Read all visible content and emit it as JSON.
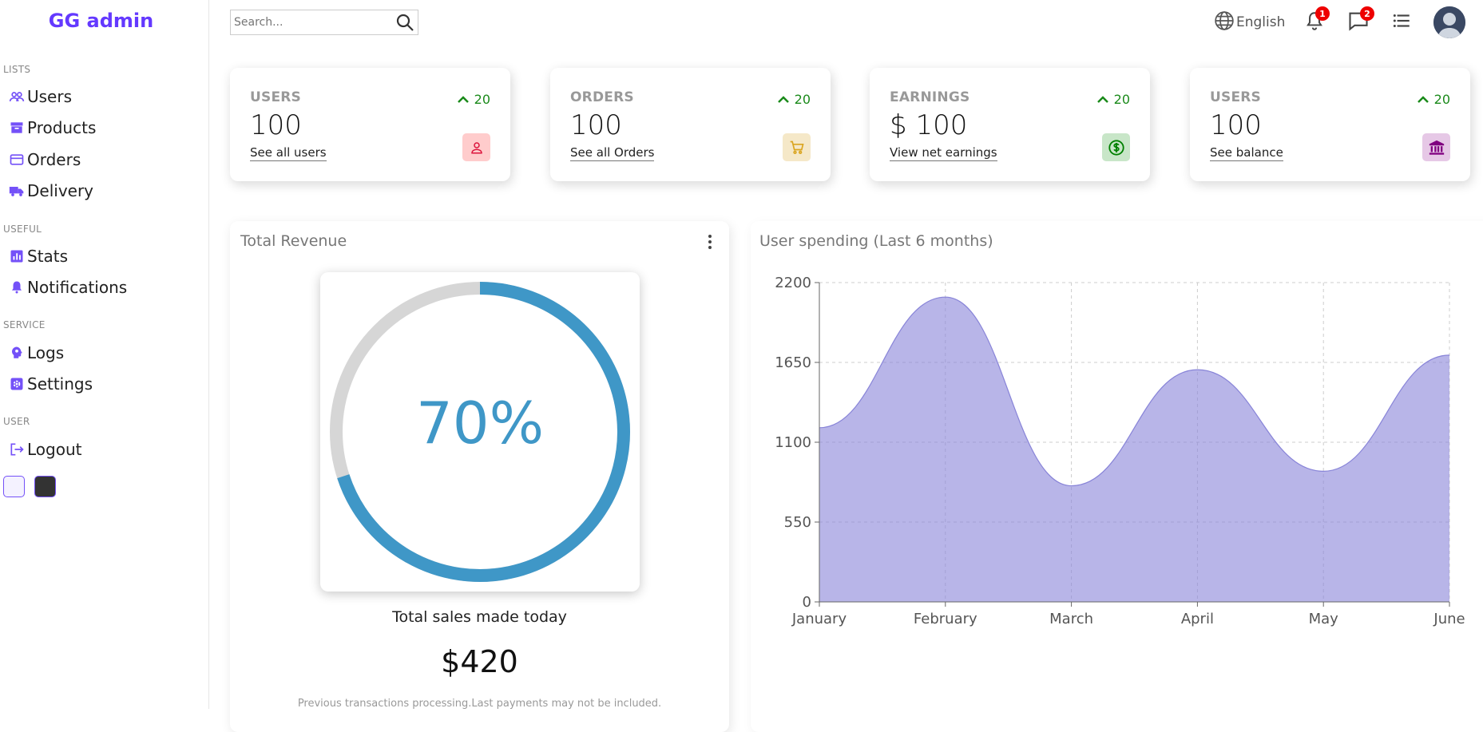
{
  "sidebar": {
    "logo": "GG admin",
    "sections": [
      {
        "title": "LISTS",
        "items": [
          {
            "label": "Users",
            "icon": "people-icon"
          },
          {
            "label": "Products",
            "icon": "archive-icon"
          },
          {
            "label": "Orders",
            "icon": "credit-card-icon"
          },
          {
            "label": "Delivery",
            "icon": "truck-icon"
          }
        ]
      },
      {
        "title": "USEFUL",
        "items": [
          {
            "label": "Stats",
            "icon": "bar-chart-icon"
          },
          {
            "label": "Notifications",
            "icon": "bell-icon"
          }
        ]
      },
      {
        "title": "SERVICE",
        "items": [
          {
            "label": "Logs",
            "icon": "brain-icon"
          },
          {
            "label": "Settings",
            "icon": "settings-icon"
          }
        ]
      },
      {
        "title": "USER",
        "items": [
          {
            "label": "Logout",
            "icon": "logout-icon"
          }
        ]
      }
    ],
    "theme_options": [
      {
        "name": "light",
        "color": "#f4f2ff"
      },
      {
        "name": "dark",
        "color": "#333333"
      }
    ]
  },
  "topbar": {
    "search_placeholder": "Search...",
    "language": "English",
    "notifications_count": "1",
    "messages_count": "2"
  },
  "widgets": [
    {
      "title": "USERS",
      "amount": "100",
      "link": "See all users",
      "diff": "20",
      "icon": "person-icon",
      "icon_color": "#dc143c",
      "icon_bg": "#ffcccc"
    },
    {
      "title": "ORDERS",
      "amount": "100",
      "link": "See all Orders",
      "diff": "20",
      "icon": "cart-icon",
      "icon_color": "#daa520",
      "icon_bg": "#f5e8c8"
    },
    {
      "title": "EARNINGS",
      "amount": "$ 100",
      "link": "View net earnings",
      "diff": "20",
      "icon": "dollar-icon",
      "icon_color": "#008000",
      "icon_bg": "#c8e6c8"
    },
    {
      "title": "USERS",
      "amount": "100",
      "link": "See balance",
      "diff": "20",
      "icon": "bank-icon",
      "icon_color": "#800080",
      "icon_bg": "#e6c8e6"
    }
  ],
  "featured": {
    "title": "Total Revenue",
    "progress_percent": 70,
    "progress_label": "70%",
    "subtitle": "Total sales made today",
    "amount": "$420",
    "description": "Previous transactions processing.Last payments may not be included.",
    "colors": {
      "track": "#d6d6d6",
      "bar": "#3f97c7"
    }
  },
  "chart_data": {
    "type": "area",
    "title": "User spending (Last 6 months)",
    "categories": [
      "January",
      "February",
      "March",
      "April",
      "May",
      "June"
    ],
    "series": [
      {
        "values": [
          1200,
          2100,
          800,
          1600,
          900,
          1700
        ]
      }
    ],
    "ylim": [
      0,
      2200
    ],
    "yticks": [
      0,
      550,
      1100,
      1650,
      2200
    ],
    "grid": true,
    "colors": {
      "fill": "#8884d8",
      "stroke": "#8884d8"
    }
  }
}
